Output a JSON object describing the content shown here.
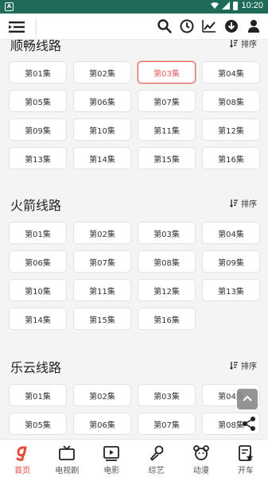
{
  "statusbar": {
    "time": "10:20",
    "left_badge": "A"
  },
  "colors": {
    "accent": "#e66060",
    "statusbar": "#1f6b5a",
    "nav_active": "#e64b3c"
  },
  "appbar": {
    "icons": [
      "menu-icon",
      "search-icon",
      "clock-icon",
      "trend-icon",
      "download-icon",
      "user-icon"
    ]
  },
  "sort_label": "排序",
  "sections": [
    {
      "title": "顺畅线路",
      "episodes": [
        "第01集",
        "第02集",
        "第03集",
        "第04集",
        "第05集",
        "第06集",
        "第07集",
        "第08集",
        "第09集",
        "第10集",
        "第11集",
        "第12集",
        "第13集",
        "第14集",
        "第15集",
        "第16集"
      ],
      "active_index": 2
    },
    {
      "title": "火箭线路",
      "episodes": [
        "第01集",
        "第02集",
        "第03集",
        "第04集",
        "第06集",
        "第07集",
        "第08集",
        "第09集",
        "第10集",
        "第11集",
        "第12集",
        "第13集",
        "第14集",
        "第15集",
        "第16集"
      ],
      "active_index": -1
    },
    {
      "title": "乐云线路",
      "episodes": [
        "第01集",
        "第02集",
        "第03集",
        "第04集",
        "第05集",
        "第06集",
        "第07集",
        "第08集"
      ],
      "active_index": -1
    }
  ],
  "nav": [
    {
      "label": "首页",
      "icon": "home-logo-icon",
      "active": true
    },
    {
      "label": "电视剧",
      "icon": "tv-icon",
      "active": false
    },
    {
      "label": "电影",
      "icon": "movie-play-icon",
      "active": false
    },
    {
      "label": "综艺",
      "icon": "microphone-icon",
      "active": false
    },
    {
      "label": "动漫",
      "icon": "bear-icon",
      "active": false
    },
    {
      "label": "开车",
      "icon": "star-doc-icon",
      "active": false
    }
  ]
}
